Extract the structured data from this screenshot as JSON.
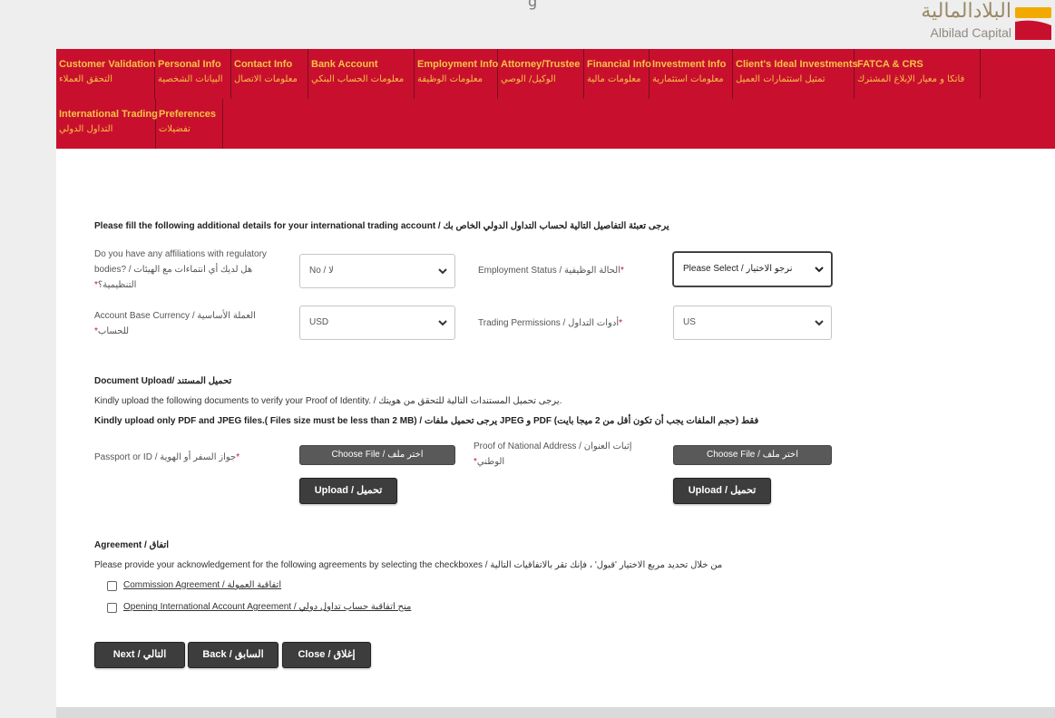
{
  "header": {
    "title_fragment": "g",
    "logo": {
      "arabic": "البلادالمالية",
      "english": "Albilad Capital"
    }
  },
  "tabs": [
    {
      "en": "Customer Validation",
      "ar": "التحقق العملاء"
    },
    {
      "en": "Personal Info",
      "ar": "البيانات الشخصية"
    },
    {
      "en": "Contact Info",
      "ar": "معلومات الاتصال"
    },
    {
      "en": "Bank Account",
      "ar": "معلومات الحساب البنكي"
    },
    {
      "en": "Employment Info",
      "ar": "معلومات الوظيفة"
    },
    {
      "en": "Attorney/Trustee",
      "ar": "الوكيل/ الوصي"
    },
    {
      "en": "Financial Info",
      "ar": "معلومات مالية"
    },
    {
      "en": "Investment Info",
      "ar": "معلومات استثمارية"
    },
    {
      "en": "Client's Ideal Investments",
      "ar": "تمثيل استثمارات العميل"
    },
    {
      "en": "FATCA & CRS",
      "ar": "فاتكا و معيار الإبلاغ المشترك"
    },
    {
      "en": "International Trading",
      "ar": "التداول الدولي"
    },
    {
      "en": "Preferences",
      "ar": "تفضيلات"
    }
  ],
  "form": {
    "intro": "Please fill the following additional details for your international trading account / يرجى تعبئة التفاصيل التالية لحساب التداول الدولي الخاص بك",
    "affiliations": {
      "label_1": "Do you have any affiliations with regulatory",
      "label_2": "bodies? / هل لديك أي انتماءات مع الهيئات",
      "label_3": "التنظيمية؟",
      "req": "*",
      "value": "No / لا"
    },
    "employment_status": {
      "label": "Employment Status / الحالة الوظيفية",
      "req": "*",
      "value": "Please Select / نرجو الاختيار"
    },
    "base_currency": {
      "label_1": "Account Base Currency / العملة الأساسية",
      "label_2": "للحساب",
      "req": "*",
      "value": "USD"
    },
    "trading_permissions": {
      "label": "Trading Permissions / أدوات التداول",
      "req": "*",
      "value": "US"
    }
  },
  "documents": {
    "heading": "Document Upload/ تحميل المستند",
    "instruction": "Kindly upload the following documents to verify your Proof of Identity. / يرجى تحميل المستندات التالية للتحقق من هويتك.",
    "format_note": "Kindly upload only PDF and JPEG files.( Files size must be less than 2 MB) / يرجى تحميل ملفات JPEG و PDF فقط (حجم الملفات يجب أن تكون أقل من 2 ميجا بايت)",
    "passport": {
      "label": "Passport or ID / جواز السفر أو الهوية",
      "req": "*",
      "choose": "Choose File / اختر ملف",
      "upload": "Upload / تحميل"
    },
    "address": {
      "label_1": "Proof of National Address / إثبات العنوان",
      "label_2": "الوطني",
      "req": "*",
      "choose": "Choose File / اختر ملف",
      "upload": "Upload / تحميل"
    }
  },
  "agreement": {
    "heading": "Agreement / اتفاق",
    "instruction": "Please provide your acknowledgement for the following agreements by selecting the checkboxes / من خلال تحديد مربع الاختيار 'قبول' ، فإنك تقر بالاتفاقيات التالية",
    "items": [
      {
        "label": "Commission Agreement / اتفاقية العمولة"
      },
      {
        "label": "Opening International Account Agreement / منح اتفاقية حساب تداول دولي"
      }
    ]
  },
  "buttons": {
    "next": "Next / التالي",
    "back": "Back / السابق",
    "close": "Close / إغلاق"
  },
  "colors": {
    "nav_bg": "#c8102e",
    "nav_text": "#f6c343",
    "button_bg": "#3d3d3d",
    "required": "#c8102e"
  }
}
